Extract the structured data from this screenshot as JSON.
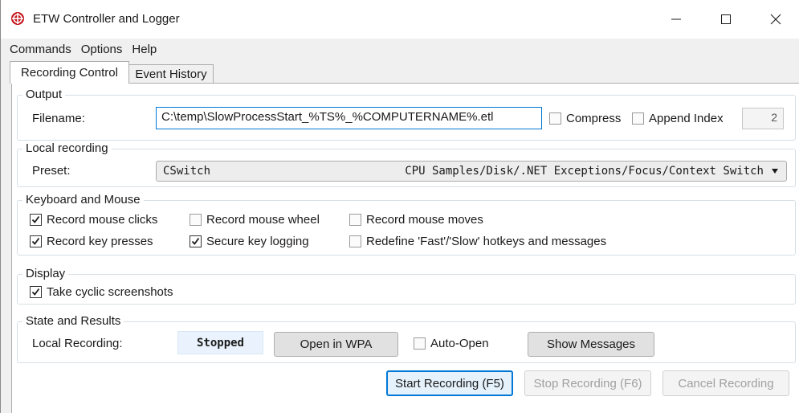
{
  "window": {
    "title": "ETW Controller and Logger",
    "icon": "etw-logo-icon",
    "accent_color": "#c4161c",
    "controls": [
      "minimize-icon",
      "maximize-icon",
      "close-icon"
    ]
  },
  "menu": {
    "items": [
      {
        "label": "Commands"
      },
      {
        "label": "Options"
      },
      {
        "label": "Help"
      }
    ]
  },
  "tabs": [
    {
      "label": "Recording Control",
      "active": true
    },
    {
      "label": "Event History",
      "active": false
    }
  ],
  "output": {
    "group_label": "Output",
    "filename_label": "Filename:",
    "filename_value": "C:\\temp\\SlowProcessStart_%TS%_%COMPUTERNAME%.etl",
    "compress_label": "Compress",
    "compress_checked": false,
    "append_index_label": "Append Index",
    "append_index_checked": false,
    "index_value": "2"
  },
  "local_recording": {
    "group_label": "Local recording",
    "preset_label": "Preset:",
    "preset_name": "CSwitch",
    "preset_description": "CPU Samples/Disk/.NET Exceptions/Focus/Context Switch"
  },
  "keyboard_mouse": {
    "group_label": "Keyboard and Mouse",
    "options": [
      {
        "label": "Record mouse clicks",
        "checked": true
      },
      {
        "label": "Record mouse wheel",
        "checked": false
      },
      {
        "label": "Record mouse moves",
        "checked": false
      },
      {
        "label": "Record key presses",
        "checked": true
      },
      {
        "label": "Secure key logging",
        "checked": true
      },
      {
        "label": "Redefine 'Fast'/'Slow' hotkeys and messages",
        "checked": false
      }
    ]
  },
  "display": {
    "group_label": "Display",
    "cyclic_screenshots_label": "Take cyclic screenshots",
    "cyclic_screenshots_checked": true
  },
  "state": {
    "group_label": "State and Results",
    "local_recording_label": "Local Recording:",
    "status_value": "Stopped",
    "open_wpa_label": "Open in WPA",
    "auto_open_label": "Auto-Open",
    "auto_open_checked": false,
    "show_messages_label": "Show Messages"
  },
  "actions": {
    "start_label": "Start Recording (F5)",
    "stop_label": "Stop Recording (F6)",
    "cancel_label": "Cancel Recording"
  }
}
